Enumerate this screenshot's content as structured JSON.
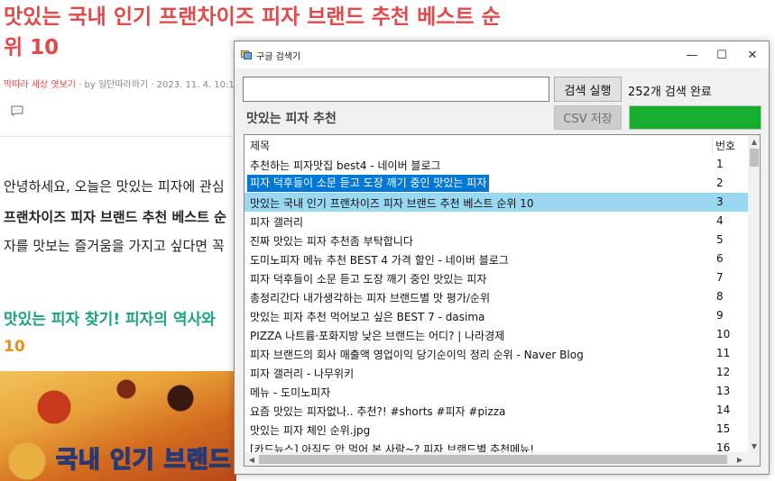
{
  "blog": {
    "title": "맛있는 국내 인기 프랜차이즈 피자 브랜드 추천 베스트 순위 10",
    "category": "막따라 세상 엿보기",
    "byline": " · by 일단따라하기 · 2023. 11. 4. 10:14",
    "para1": "안녕하세요, 오늘은 맛있는 피자에 관심",
    "para2": "프랜차이즈 피자 브랜드 추천 베스트 순",
    "para3": "자를 맛보는 즐거움을 가지고 싶다면 꼭",
    "heading": "맛있는 피자 찾기! 피자의 역사와",
    "heading_tail": "10",
    "image_caption": "국내 인기 브랜드"
  },
  "window": {
    "title": "구글 검색기",
    "minimize_glyph": "—",
    "maximize_glyph": "☐",
    "close_glyph": "✕"
  },
  "search": {
    "value": "",
    "run_label": "검색 실행",
    "status": "252개 검색 완료",
    "query_label": "맛있는 피자 추천",
    "csv_label": "CSV 저장",
    "progress": 1.0
  },
  "list": {
    "header_title": "제목",
    "header_num": "번호",
    "rows": [
      {
        "title": "추천하는 피자맛집 best4 - 네이버 블로그",
        "num": "1"
      },
      {
        "title": "피자 덕후들이 소문 듣고 도장 깨기 중인 맛있는 피자",
        "num": "2"
      },
      {
        "title": "맛있는 국내 인기 프랜차이즈 피자 브랜드 추천 베스트 순위 10",
        "num": "3"
      },
      {
        "title": "피자 갤러리",
        "num": "4"
      },
      {
        "title": "진짜 맛있는 피자 추천좀 부탁합니다",
        "num": "5"
      },
      {
        "title": "도미노피자 메뉴 추천 BEST 4 가격 할인 - 네이버 블로그",
        "num": "6"
      },
      {
        "title": "피자 덕후들이 소문 듣고 도장 깨기 중인 맛있는 피자",
        "num": "7"
      },
      {
        "title": "총정리간다 내가생각하는 피자 브랜드별 맛 평가/순위",
        "num": "8"
      },
      {
        "title": "맛있는 피자 추천 먹어보고 싶은 BEST 7 - dasima",
        "num": "9"
      },
      {
        "title": "PIZZA 나트륨·포화지방 낮은 브랜드는 어디? | 나라경제",
        "num": "10"
      },
      {
        "title": "피자 브랜드의 회사 매출액 영업이익 당기순이익 정리 순위 - Naver Blog",
        "num": "11"
      },
      {
        "title": "피자 갤러리 - 나무위키",
        "num": "12"
      },
      {
        "title": "메뉴 - 도미노피자",
        "num": "13"
      },
      {
        "title": "요즘 맛있는 피자없나.. 추천?! #shorts #피자 #pizza",
        "num": "14"
      },
      {
        "title": "맛있는 피자 체인 순위.jpg",
        "num": "15"
      },
      {
        "title": "[카드뉴스] 아직도 안 먹어 본 사람~? 피자 브랜드별 추천메뉴!",
        "num": "16"
      }
    ]
  },
  "colors": {
    "progress_fill": "#17ad2e",
    "selection_focus": "#0078d7",
    "selection_hover": "#99d8f0",
    "blog_title": "#e04a4a",
    "blog_heading": "#1ba37a"
  }
}
